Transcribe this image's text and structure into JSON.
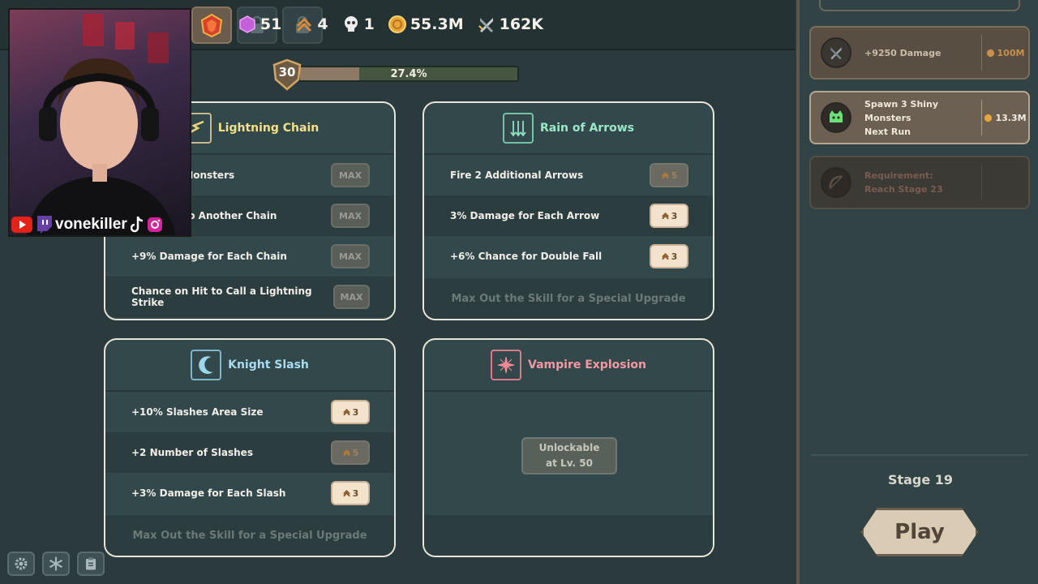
{
  "tabs": [
    {
      "icon": "gem-shield-icon",
      "active": true
    },
    {
      "icon": "lock-icon",
      "active": false
    },
    {
      "icon": "lock-icon",
      "active": false
    }
  ],
  "currencies": [
    {
      "icon": "pink-gem-icon",
      "value": "51"
    },
    {
      "icon": "rank-chevron-icon",
      "value": "4"
    },
    {
      "icon": "skull-icon",
      "value": "1"
    },
    {
      "icon": "gold-coin-icon",
      "value": "55.3M"
    },
    {
      "icon": "sword-icon",
      "value": "162K"
    }
  ],
  "level": {
    "number": "30",
    "progress_text": "27.4%",
    "progress": 0.274
  },
  "cards": {
    "lightning": {
      "title": "Lightning Chain",
      "rows": [
        {
          "label": "dditional Monsters",
          "btn": "MAX"
        },
        {
          "label": "e to Fork to Another Chain",
          "btn": "MAX"
        },
        {
          "label": "+9% Damage for Each Chain",
          "btn": "MAX"
        },
        {
          "label": "Chance on Hit to Call a Lightning Strike",
          "btn": "MAX"
        }
      ]
    },
    "arrows": {
      "title": "Rain of Arrows",
      "rows": [
        {
          "label": "Fire 2 Additional Arrows",
          "btn": "5"
        },
        {
          "label": "3% Damage for Each Arrow",
          "btn": "3"
        },
        {
          "label": "+6% Chance for Double Fall",
          "btn": "3"
        }
      ],
      "footer": "Max Out the Skill for a Special Upgrade"
    },
    "knight": {
      "title": "Knight Slash",
      "rows": [
        {
          "label": "+10% Slashes Area Size",
          "btn": "3"
        },
        {
          "label": "+2 Number of Slashes",
          "btn": "5"
        },
        {
          "label": "+3% Damage for Each Slash",
          "btn": "3"
        }
      ],
      "footer": "Max Out the Skill for a Special Upgrade"
    },
    "vampire": {
      "title": "Vampire Explosion",
      "unlock_line1": "Unlockable",
      "unlock_line2": "at Lv. 50"
    }
  },
  "sidebar": {
    "offers": [
      {
        "text1": "+9250 Damage",
        "text2": "",
        "price": "100M"
      },
      {
        "text1": "Spawn 3 Shiny Monsters",
        "text2": "Next Run",
        "price": "13.3M"
      },
      {
        "text1": "Requirement:",
        "text2": "Reach Stage 23",
        "price": ""
      }
    ],
    "stage": "Stage 19",
    "play": "Play"
  },
  "streamer": {
    "handle": "vonekiller"
  },
  "colors": {
    "accent_gold": "#e8a53a",
    "card_border": "#e7e4d9",
    "cost_button": "#f3e2cc"
  }
}
